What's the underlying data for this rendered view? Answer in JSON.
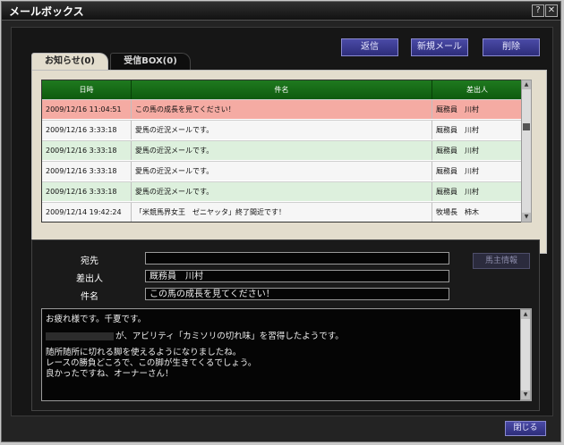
{
  "window": {
    "title": "メールボックス",
    "help_label": "?",
    "close_label": "✕"
  },
  "toolbar": {
    "send_label": "返信",
    "new_label": "新規メール",
    "delete_label": "削除"
  },
  "tabs": [
    {
      "label": "お知らせ(0)",
      "active": true
    },
    {
      "label": "受信BOX(0)",
      "active": false
    }
  ],
  "table": {
    "headers": {
      "date": "日時",
      "subject": "件名",
      "sender": "差出人"
    },
    "rows": [
      {
        "date": "2009/12/16 11:04:51",
        "subject": "この馬の成長を見てください！",
        "sender": "厩務員　川村",
        "style": "selected"
      },
      {
        "date": "2009/12/16 3:33:18",
        "subject": "愛馬の近況メールです。",
        "sender": "厩務員　川村",
        "style": "white"
      },
      {
        "date": "2009/12/16 3:33:18",
        "subject": "愛馬の近況メールです。",
        "sender": "厩務員　川村",
        "style": "green"
      },
      {
        "date": "2009/12/16 3:33:18",
        "subject": "愛馬の近況メールです。",
        "sender": "厩務員　川村",
        "style": "white"
      },
      {
        "date": "2009/12/16 3:33:18",
        "subject": "愛馬の近況メールです。",
        "sender": "厩務員　川村",
        "style": "green"
      },
      {
        "date": "2009/12/14 19:42:24",
        "subject": "「米競馬界女王　ゼニヤッタ」終了間近です！",
        "sender": "牧場長　柿木",
        "style": "white"
      }
    ]
  },
  "detail": {
    "to_label": "宛先",
    "to_value": "",
    "from_label": "差出人",
    "from_value": "厩務員　川村",
    "subject_label": "件名",
    "subject_value": "この馬の成長を見てください！",
    "owner_info_label": "馬主情報",
    "body": {
      "line1": "お疲れ様です。千夏です。",
      "line2": "が、アビリティ「カミソリの切れ味」を習得したようです。",
      "line3": "随所随所に切れる脚を使えるようになりましたね。",
      "line4": "レースの勝負どころで、この脚が生きてくるでしょう。",
      "line5": "良かったですね、オーナーさん！"
    }
  },
  "footer": {
    "close_label": "閉じる"
  },
  "colors": {
    "row_selected": "#f5aba3",
    "row_green": "#ddf0dd",
    "row_white": "#f6f6f6",
    "header_green": "#137213",
    "button_blue": "#3a3a90"
  }
}
